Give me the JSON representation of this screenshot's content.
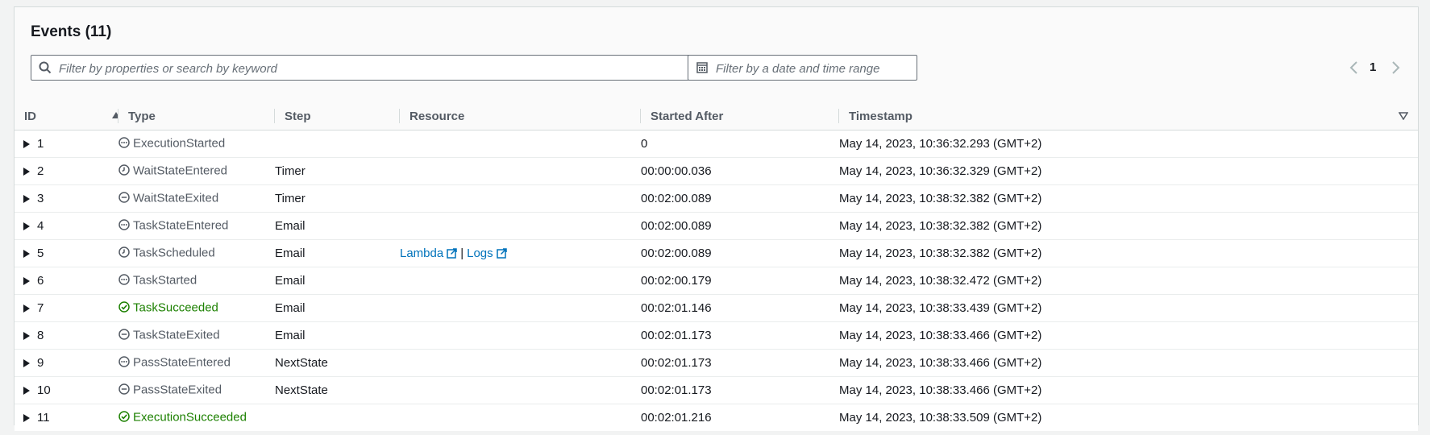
{
  "panel": {
    "title": "Events (11)",
    "search_placeholder": "Filter by properties or search by keyword",
    "date_placeholder": "Filter by a date and time range",
    "page_number": "1"
  },
  "columns": {
    "id": "ID",
    "type": "Type",
    "step": "Step",
    "resource": "Resource",
    "started_after": "Started After",
    "timestamp": "Timestamp"
  },
  "rows": [
    {
      "id": "1",
      "type": "ExecutionStarted",
      "status": "info",
      "step": "",
      "started_after": "0",
      "timestamp": "May 14, 2023, 10:36:32.293 (GMT+2)"
    },
    {
      "id": "2",
      "type": "WaitStateEntered",
      "status": "clock",
      "step": "Timer",
      "started_after": "00:00:00.036",
      "timestamp": "May 14, 2023, 10:36:32.329 (GMT+2)"
    },
    {
      "id": "3",
      "type": "WaitStateExited",
      "status": "minus",
      "step": "Timer",
      "started_after": "00:02:00.089",
      "timestamp": "May 14, 2023, 10:38:32.382 (GMT+2)"
    },
    {
      "id": "4",
      "type": "TaskStateEntered",
      "status": "info",
      "step": "Email",
      "started_after": "00:02:00.089",
      "timestamp": "May 14, 2023, 10:38:32.382 (GMT+2)"
    },
    {
      "id": "5",
      "type": "TaskScheduled",
      "status": "clock",
      "step": "Email",
      "started_after": "00:02:00.089",
      "timestamp": "May 14, 2023, 10:38:32.382 (GMT+2)",
      "resource": {
        "lambda": "Lambda",
        "separator": "|",
        "logs": "Logs"
      }
    },
    {
      "id": "6",
      "type": "TaskStarted",
      "status": "info",
      "step": "Email",
      "started_after": "00:02:00.179",
      "timestamp": "May 14, 2023, 10:38:32.472 (GMT+2)"
    },
    {
      "id": "7",
      "type": "TaskSucceeded",
      "status": "success",
      "step": "Email",
      "started_after": "00:02:01.146",
      "timestamp": "May 14, 2023, 10:38:33.439 (GMT+2)"
    },
    {
      "id": "8",
      "type": "TaskStateExited",
      "status": "minus",
      "step": "Email",
      "started_after": "00:02:01.173",
      "timestamp": "May 14, 2023, 10:38:33.466 (GMT+2)"
    },
    {
      "id": "9",
      "type": "PassStateEntered",
      "status": "info",
      "step": "NextState",
      "started_after": "00:02:01.173",
      "timestamp": "May 14, 2023, 10:38:33.466 (GMT+2)"
    },
    {
      "id": "10",
      "type": "PassStateExited",
      "status": "minus",
      "step": "NextState",
      "started_after": "00:02:01.173",
      "timestamp": "May 14, 2023, 10:38:33.466 (GMT+2)"
    },
    {
      "id": "11",
      "type": "ExecutionSucceeded",
      "status": "success",
      "step": "",
      "started_after": "00:02:01.216",
      "timestamp": "May 14, 2023, 10:38:33.509 (GMT+2)"
    }
  ],
  "colors": {
    "success": "#1d8102",
    "neutral": "#545b64",
    "link": "#0073bb"
  }
}
